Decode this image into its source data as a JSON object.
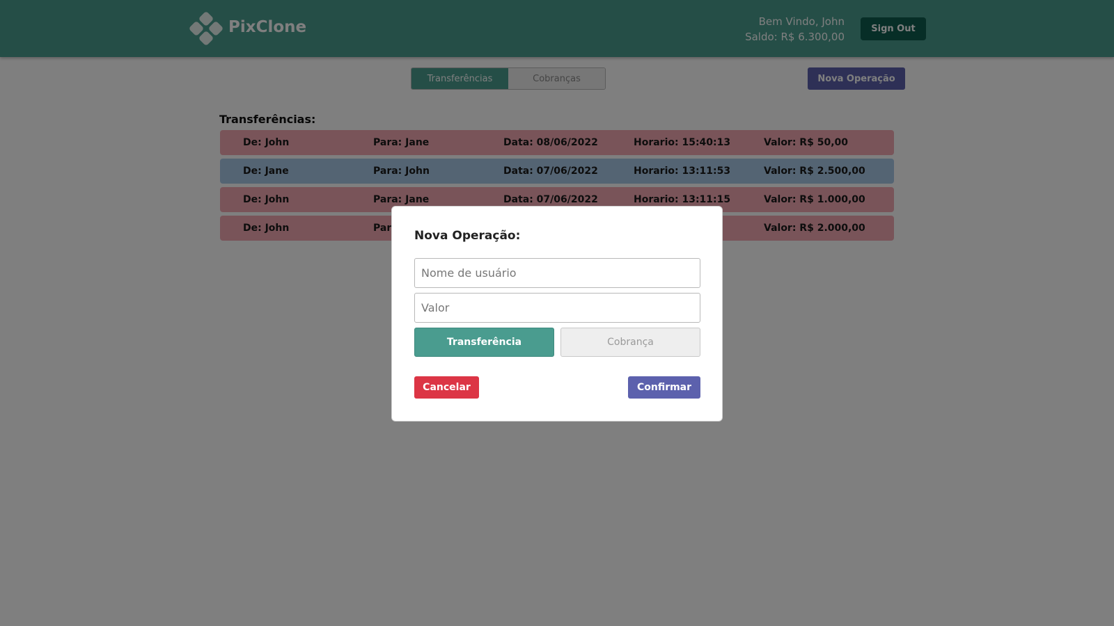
{
  "header": {
    "brand": "PixClone",
    "logo_icon": "diamond-cluster-logo-icon",
    "welcome": "Bem Vindo, John",
    "balance": "Saldo: R$ 6.300,00",
    "signout_label": "Sign Out"
  },
  "tabs": {
    "items": [
      {
        "label": "Transferências",
        "active": true
      },
      {
        "label": "Cobranças",
        "active": false
      }
    ]
  },
  "actions": {
    "nova_operacao_label": "Nova Operação"
  },
  "main": {
    "section_title": "Transferências:",
    "rows": [
      {
        "de": "De: John",
        "para": "Para: Jane",
        "data": "Data: 08/06/2022",
        "horario": "Horario: 15:40:13",
        "valor": "Valor: R$ 50,00",
        "kind": "out"
      },
      {
        "de": "De: Jane",
        "para": "Para: John",
        "data": "Data: 07/06/2022",
        "horario": "Horario: 13:11:53",
        "valor": "Valor: R$ 2.500,00",
        "kind": "in"
      },
      {
        "de": "De: John",
        "para": "Para: Jane",
        "data": "Data: 07/06/2022",
        "horario": "Horario: 13:11:15",
        "valor": "Valor: R$ 1.000,00",
        "kind": "out"
      },
      {
        "de": "De: John",
        "para": "Para",
        "data": "",
        "horario": "",
        "valor": "Valor: R$ 2.000,00",
        "kind": "out"
      }
    ]
  },
  "modal": {
    "title": "Nova Operação:",
    "username_placeholder": "Nome de usuário",
    "username_value": "",
    "valor_placeholder": "Valor",
    "valor_value": "",
    "transferencia_label": "Transferência",
    "cobranca_label": "Cobrança",
    "cancel_label": "Cancelar",
    "confirm_label": "Confirmar"
  },
  "colors": {
    "primary": "#4a9c8f",
    "header_dark": "#0e5c4e",
    "accent": "#5c61ad",
    "danger": "#dc3545",
    "row_out": "#f2a8b2",
    "row_in": "#a8c8e6"
  }
}
